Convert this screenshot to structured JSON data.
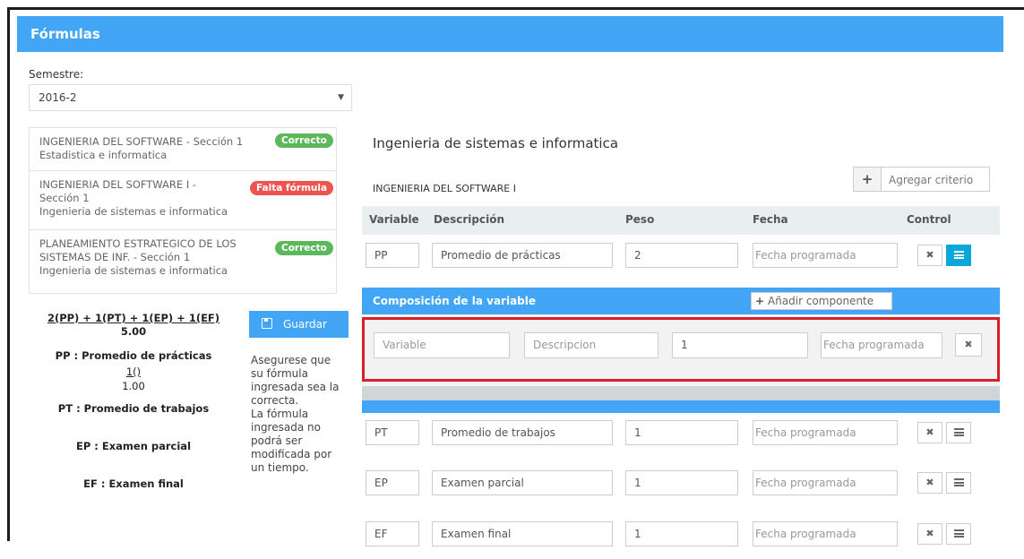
{
  "header": {
    "title": "Fórmulas"
  },
  "semester": {
    "label": "Semestre:",
    "value": "2016-2"
  },
  "courses": [
    {
      "line1": "INGENIERIA DEL SOFTWARE - Sección 1",
      "line2": "Estadistica e informatica",
      "line3": "",
      "status": "Correcto",
      "status_color": "#5cb85c"
    },
    {
      "line1": "INGENIERIA DEL SOFTWARE I -",
      "line2": "Sección 1",
      "line3": "Ingenieria de sistemas e informatica",
      "status": "Falta fórmula",
      "status_color": "#ef5350"
    },
    {
      "line1": "PLANEAMIENTO ESTRATEGICO DE LOS",
      "line2": "SISTEMAS DE INF. - Sección 1",
      "line3": "Ingenieria de sistemas e informatica",
      "status": "Correcto",
      "status_color": "#5cb85c"
    }
  ],
  "formula": {
    "expression": "2(PP) + 1(PT) + 1(EP) + 1(EF)",
    "result": "5.00",
    "pp_label": "PP : Promedio de prácticas",
    "pp_expr": "1()",
    "pp_value": "1.00",
    "pt_label": "PT : Promedio de trabajos",
    "ep_label": "EP : Examen parcial",
    "ef_label": "EF : Examen final"
  },
  "save_button": {
    "label": "Guardar"
  },
  "note": [
    "Asegurese que",
    "su fórmula",
    "ingresada sea la",
    "correcta.",
    "La fórmula",
    "ingresada no",
    "podrá ser",
    "modificada por",
    "un tiempo."
  ],
  "right": {
    "title": "Ingenieria de sistemas e informatica",
    "subtitle": "INGENIERIA DEL SOFTWARE I",
    "add_criteria": "Agregar criterio"
  },
  "table": {
    "headers": {
      "variable": "Variable",
      "description": "Descripción",
      "weight": "Peso",
      "date": "Fecha",
      "control": "Control"
    },
    "rows": [
      {
        "variable": "PP",
        "description": "Promedio de prácticas",
        "weight": "2",
        "date_placeholder": "Fecha programada",
        "list_active": true
      },
      {
        "variable": "PT",
        "description": "Promedio de trabajos",
        "weight": "1",
        "date_placeholder": "Fecha programada",
        "list_active": false
      },
      {
        "variable": "EP",
        "description": "Examen parcial",
        "weight": "1",
        "date_placeholder": "Fecha programada",
        "list_active": false
      },
      {
        "variable": "EF",
        "description": "Examen final",
        "weight": "1",
        "date_placeholder": "Fecha programada",
        "list_active": false
      }
    ]
  },
  "composition": {
    "title": "Composición de la variable",
    "add_component": "Añadir componente",
    "variable_placeholder": "Variable",
    "description_placeholder": "Descripcion",
    "weight_value": "1",
    "date_placeholder": "Fecha programada"
  },
  "icons": {
    "remove": "times-icon",
    "list": "list-icon",
    "save": "floppy-icon",
    "plus": "plus-icon",
    "dropdown": "caret-down-icon"
  }
}
